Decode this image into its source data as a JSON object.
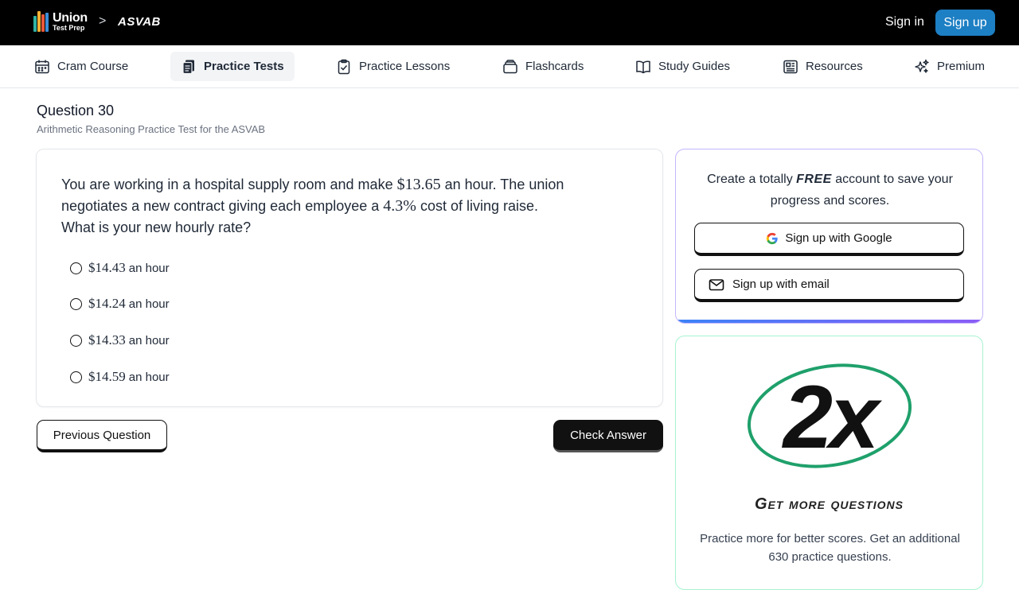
{
  "header": {
    "logo_line1": "Union",
    "logo_line2": "Test Prep",
    "breadcrumb_separator": ">",
    "breadcrumb": "ASVAB",
    "sign_in": "Sign in",
    "sign_up": "Sign up"
  },
  "nav": {
    "items": [
      {
        "label": "Cram Course",
        "icon": "calendar-icon"
      },
      {
        "label": "Practice Tests",
        "icon": "documents-icon",
        "active": true
      },
      {
        "label": "Practice Lessons",
        "icon": "clipboard-check-icon"
      },
      {
        "label": "Flashcards",
        "icon": "flashcards-icon"
      },
      {
        "label": "Study Guides",
        "icon": "open-book-icon"
      },
      {
        "label": "Resources",
        "icon": "newspaper-icon"
      },
      {
        "label": "Premium",
        "icon": "sparkles-icon"
      }
    ]
  },
  "question": {
    "title": "Question 30",
    "subtitle": "Arithmetic Reasoning Practice Test for the ASVAB",
    "text_part1": "You are working in a hospital supply room and make ",
    "math1": "$13.65",
    "text_part2": " an hour. The union negotiates a new contract giving each employee a ",
    "math2": "4.3%",
    "text_part3": " cost of living raise. What is your new hourly rate?",
    "options": [
      {
        "amount": "$14.43",
        "suffix": "an hour"
      },
      {
        "amount": "$14.24",
        "suffix": "an hour"
      },
      {
        "amount": "$14.33",
        "suffix": "an hour"
      },
      {
        "amount": "$14.59",
        "suffix": "an hour"
      }
    ]
  },
  "actions": {
    "previous": "Previous Question",
    "check": "Check Answer"
  },
  "signup_card": {
    "text_before": "Create a totally ",
    "free": "FREE",
    "text_after": " account to save your progress and scores.",
    "google_button": "Sign up with Google",
    "email_button": "Sign up with email"
  },
  "promo_card": {
    "badge": "2x",
    "title": "Get more questions",
    "text": "Practice more for better scores. Get an additional 630 practice questions."
  },
  "colors": {
    "brand_blue": "#1d7fc4",
    "promo_green": "#1fa06b",
    "accent_purple": "#8b5cf6"
  }
}
